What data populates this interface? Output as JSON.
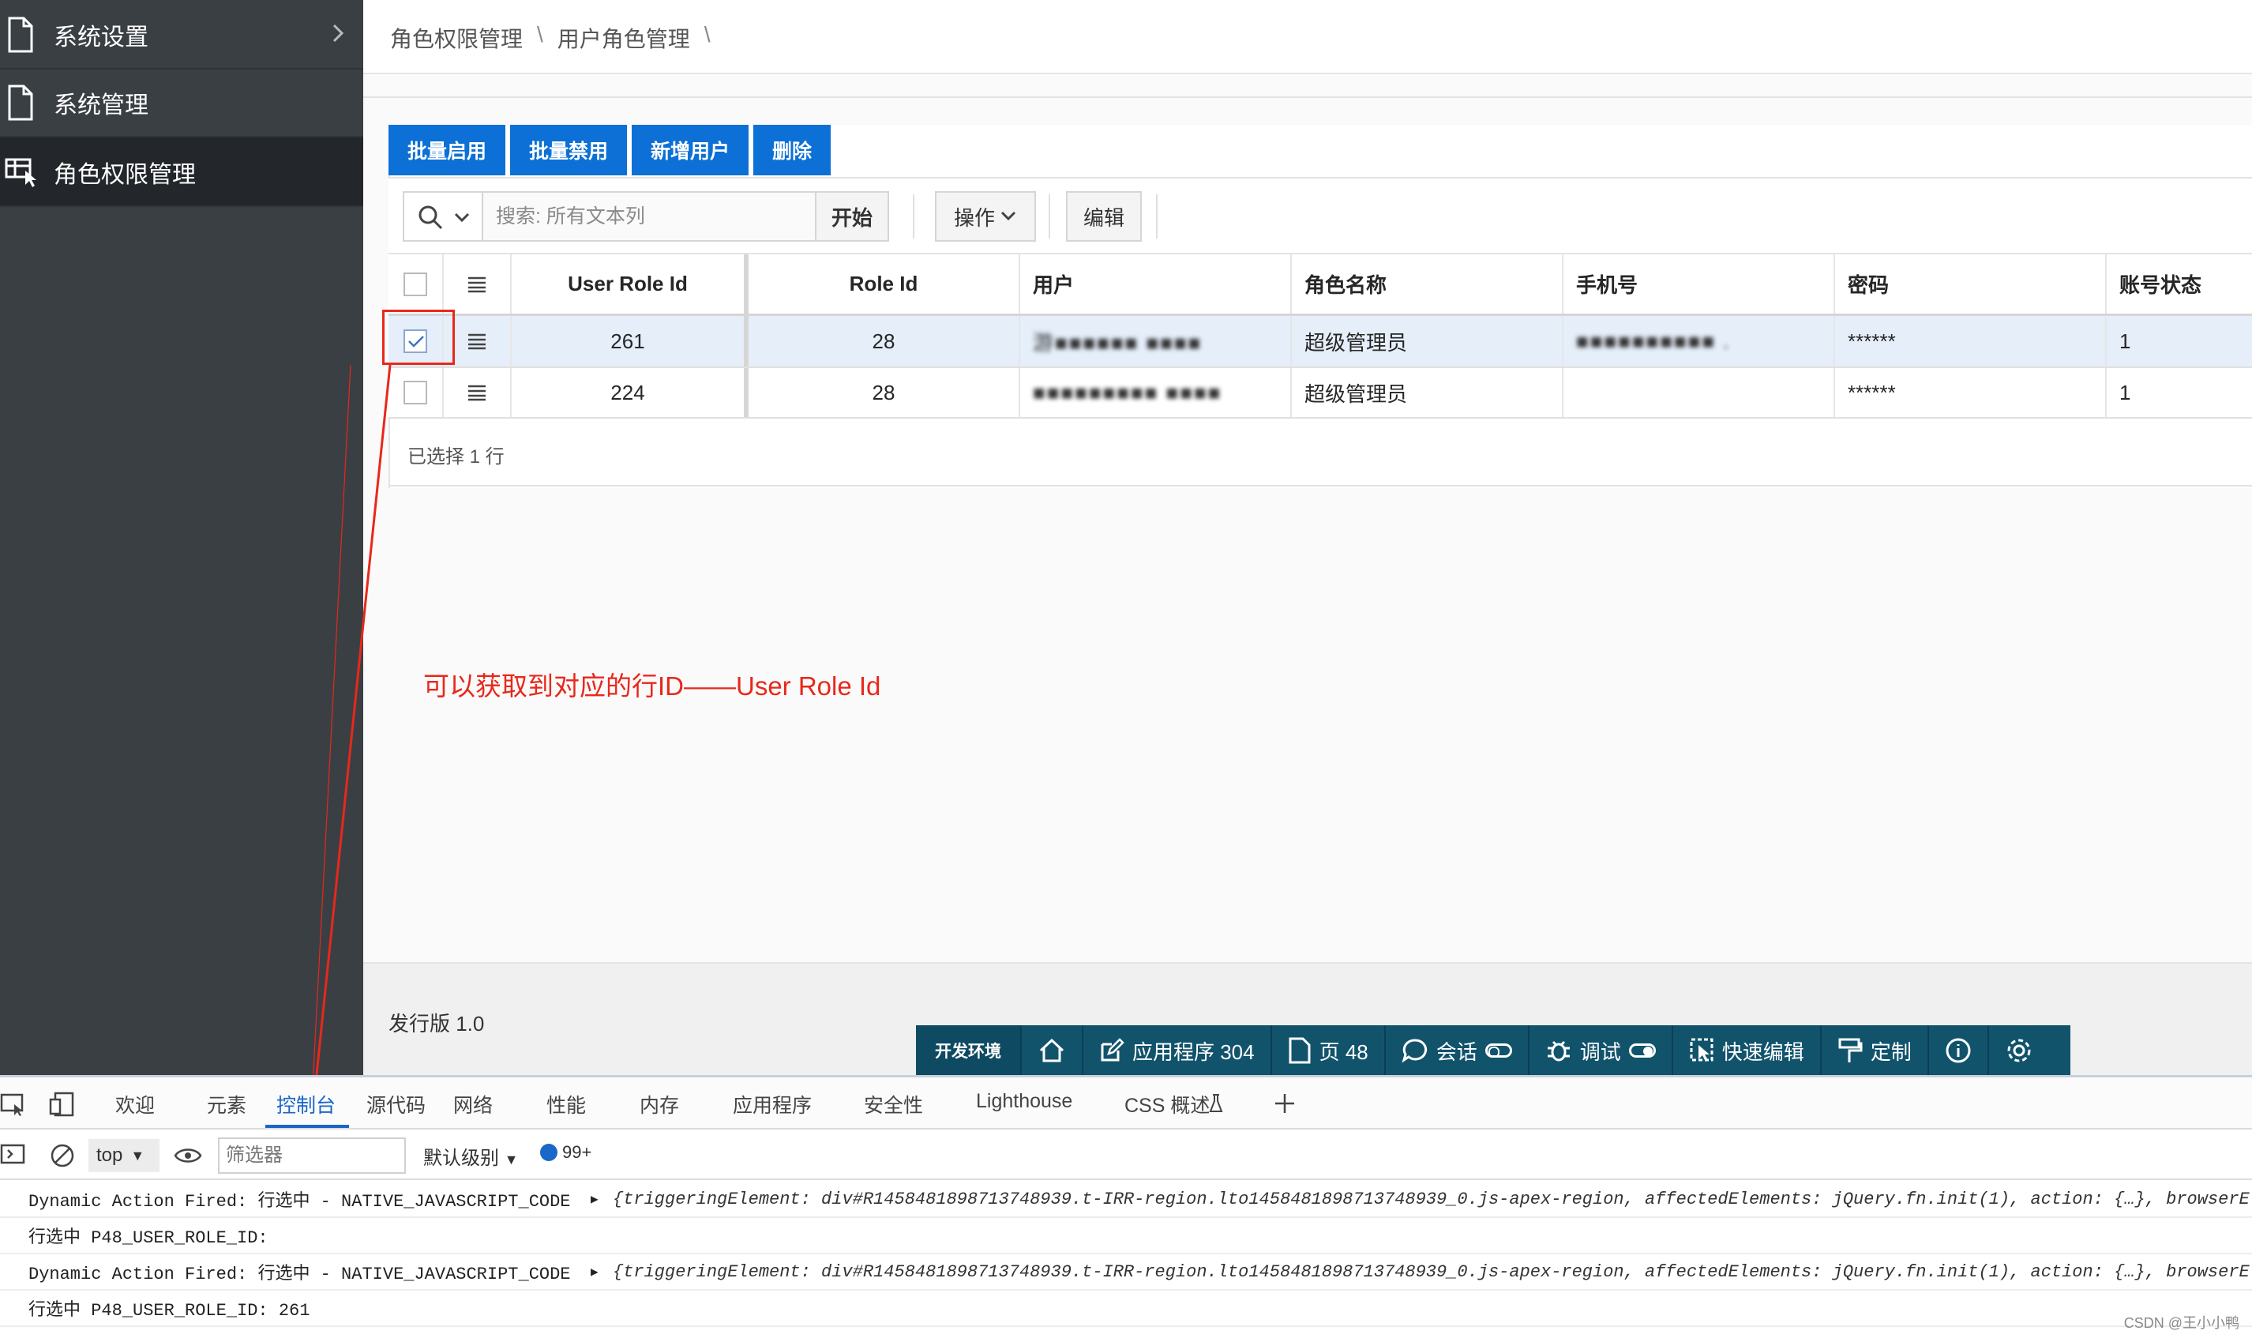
{
  "sidebar": {
    "items": [
      {
        "label": "系统设置",
        "has_chevron": true
      },
      {
        "label": "系统管理",
        "has_chevron": false
      },
      {
        "label": "角色权限管理",
        "active": true
      }
    ]
  },
  "breadcrumb": [
    "角色权限管理",
    "用户角色管理"
  ],
  "breadcrumb_sep": "\\",
  "buttons": {
    "enable": "批量启用",
    "disable": "批量禁用",
    "add_user": "新增用户",
    "delete": "删除"
  },
  "toolbar": {
    "search_placeholder": "搜索: 所有文本列",
    "go": "开始",
    "actions": "操作",
    "edit": "编辑"
  },
  "grid": {
    "columns": [
      "User Role Id",
      "Role Id",
      "用户",
      "角色名称",
      "手机号",
      "密码",
      "账号状态"
    ],
    "rows": [
      {
        "selected": true,
        "user_role_id": "261",
        "role_id": "28",
        "user": "游■■■■■■ ■■■■",
        "role_name": "超级管理员",
        "phone": "■■■■■■■■■■ .",
        "password": "******",
        "status": "1"
      },
      {
        "selected": false,
        "user_role_id": "224",
        "role_id": "28",
        "user": "■■■■■■■■■ ■■■■",
        "role_name": "超级管理员",
        "phone": "",
        "password": "******",
        "status": "1"
      }
    ],
    "selection_info": "已选择 1 行"
  },
  "annotation": "可以获取到对应的行ID——User Role Id",
  "footer": {
    "release": "发行版 1.0"
  },
  "devbar": {
    "env": "开发环境",
    "app": "应用程序 304",
    "page": "页 48",
    "session": "会话",
    "debug": "调试",
    "quick_edit": "快速编辑",
    "customize": "定制"
  },
  "devtools": {
    "tabs": [
      "欢迎",
      "元素",
      "控制台",
      "源代码",
      "网络",
      "性能",
      "内存",
      "应用程序",
      "安全性",
      "Lighthouse",
      "CSS 概述"
    ],
    "active_tab": "控制台",
    "context": "top",
    "filter_placeholder": "筛选器",
    "level": "默认级别",
    "message_count": "99+",
    "logs": [
      {
        "prefix": "Dynamic Action Fired: 行选中 - NATIVE_JAVASCRIPT_CODE",
        "obj": "{triggeringElement: div#R1458481898713748939.t-IRR-region.lto1458481898713748939_0.js-apex-region, affectedElements: jQuery.fn.init(1), action: {…}, browserE"
      },
      {
        "prefix": "行选中 P48_USER_ROLE_ID:",
        "obj": ""
      },
      {
        "prefix": "Dynamic Action Fired: 行选中 - NATIVE_JAVASCRIPT_CODE",
        "obj": "{triggeringElement: div#R1458481898713748939.t-IRR-region.lto1458481898713748939_0.js-apex-region, affectedElements: jQuery.fn.init(1), action: {…}, browserE"
      },
      {
        "prefix": "行选中 P48_USER_ROLE_ID: 261",
        "obj": ""
      }
    ]
  },
  "watermark": "CSDN @王小小鸭",
  "colors": {
    "sidebar": "#3a3f44",
    "primary": "#0c70d6",
    "devbar": "#12536c",
    "annotation": "#e8281b"
  }
}
